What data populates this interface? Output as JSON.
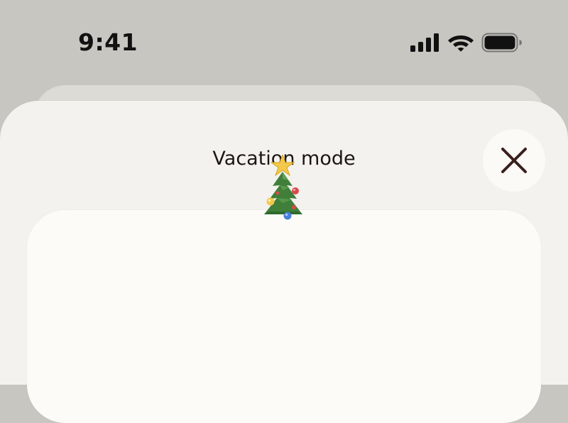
{
  "status_bar": {
    "time": "9:41",
    "icons": [
      "cellular-signal-icon",
      "wifi-icon",
      "battery-icon"
    ]
  },
  "sheet": {
    "title": "Vacation mode",
    "close_icon": "close-icon"
  },
  "card": {
    "illustration": "christmas-tree-icon"
  },
  "colors": {
    "background": "#c7c6c1",
    "sheet": "#f3f2ee",
    "card": "#fcfbf8",
    "close_button": "#fbfaf7",
    "close_icon": "#3a1f1c",
    "text": "#1b1614"
  }
}
